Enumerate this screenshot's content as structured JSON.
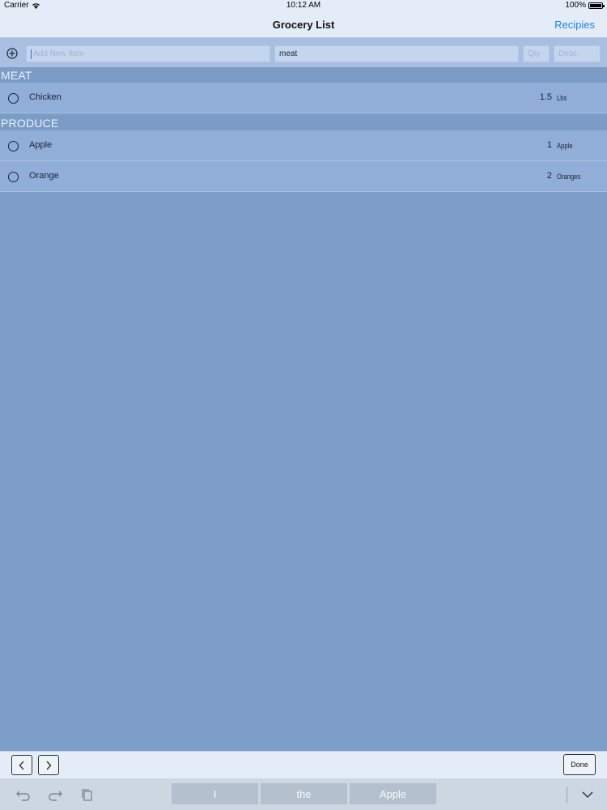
{
  "status_bar": {
    "carrier": "Carrier",
    "time": "10:12 AM",
    "battery": "100%"
  },
  "nav": {
    "title": "Grocery List",
    "right_button": "Recipies"
  },
  "add_item": {
    "name_placeholder": "Add New Item",
    "category_value": "meat",
    "qty_placeholder": "Qty",
    "desc_placeholder": "Desc"
  },
  "sections": [
    {
      "title": "MEAT",
      "items": [
        {
          "name": "Chicken",
          "qty": "1.5",
          "unit": "Lbs"
        }
      ]
    },
    {
      "title": "PRODUCE",
      "items": [
        {
          "name": "Apple",
          "qty": "1",
          "unit": "Apple"
        },
        {
          "name": "Orange",
          "qty": "2",
          "unit": "Oranges"
        }
      ]
    }
  ],
  "keyboard_toolbar": {
    "prev_icon": "chevron-left-icon",
    "next_icon": "chevron-right-icon",
    "done_label": "Done"
  },
  "predictive": {
    "suggestions": [
      "I",
      "the",
      "Apple"
    ]
  },
  "colors": {
    "background": "#7d9ec8",
    "accent": "#1e86e0",
    "row": "#90aed8",
    "section_header": "#7b9cc6"
  }
}
